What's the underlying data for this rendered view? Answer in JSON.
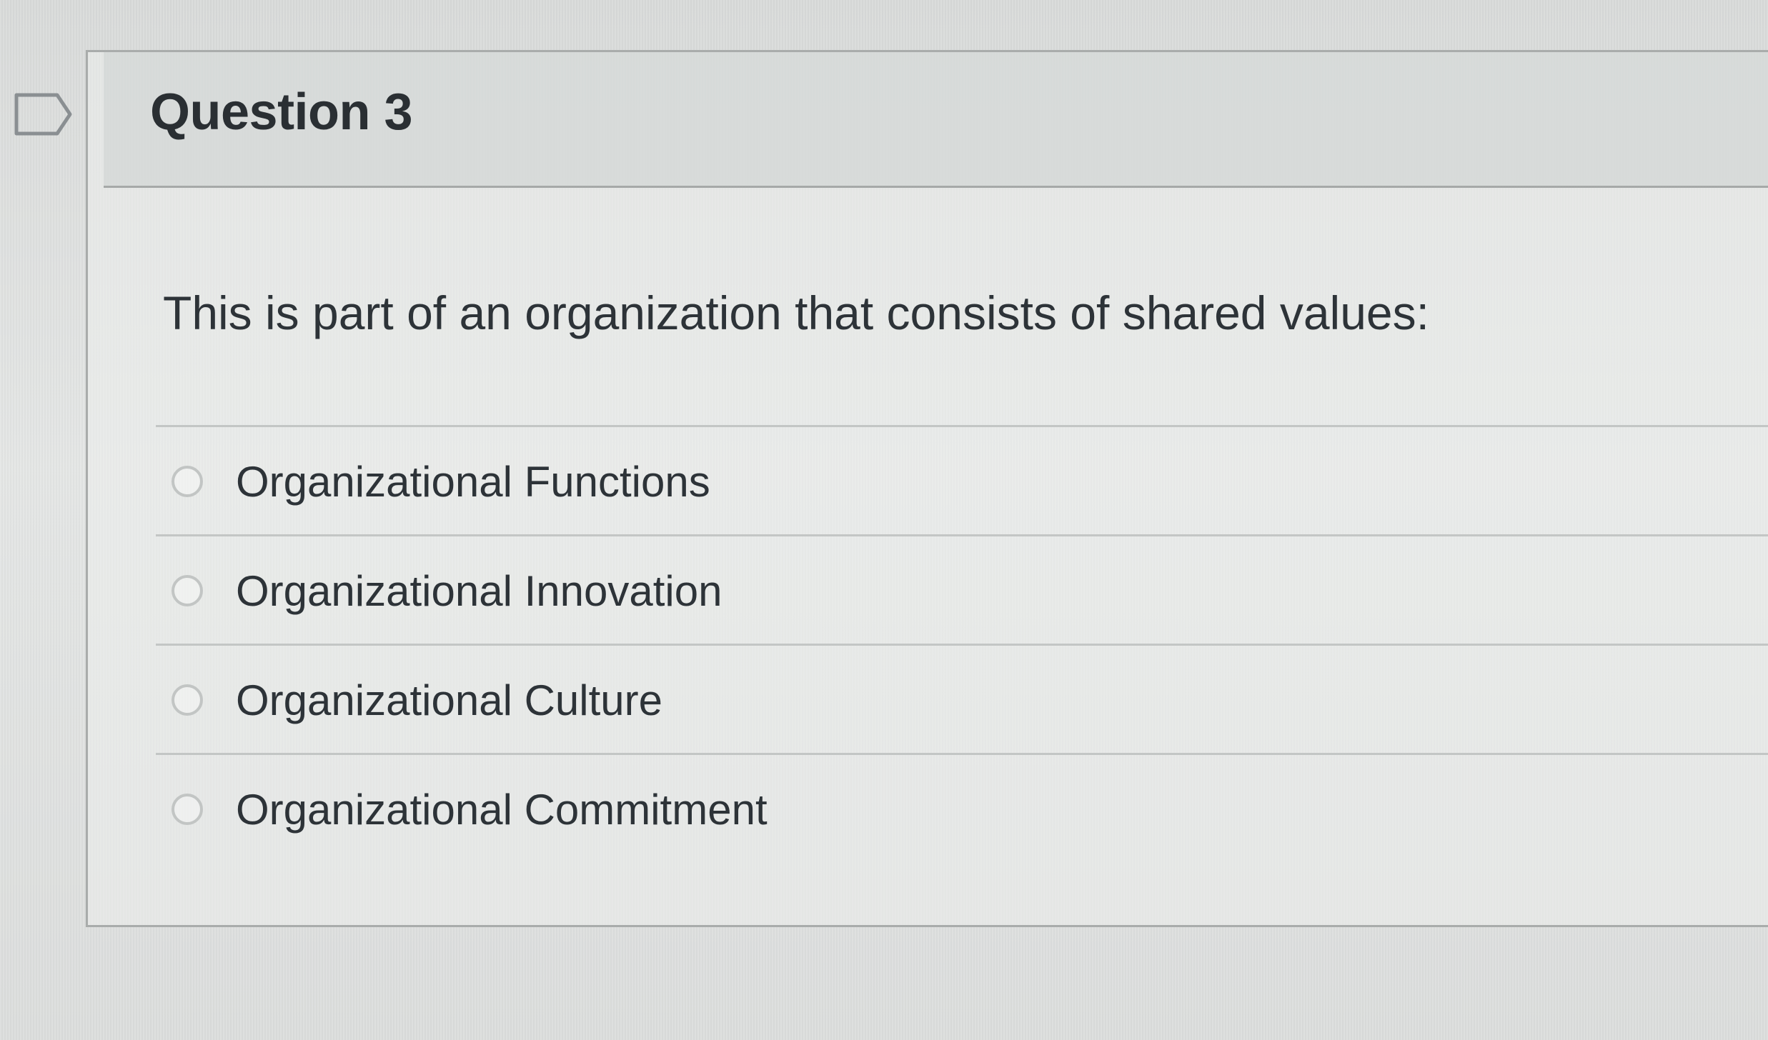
{
  "question": {
    "title": "Question 3",
    "prompt": "This is part of an organization that consists of shared values:",
    "answers": [
      {
        "label": "Organizational Functions",
        "selected": false
      },
      {
        "label": "Organizational Innovation",
        "selected": false
      },
      {
        "label": "Organizational Culture",
        "selected": false
      },
      {
        "label": "Organizational Commitment",
        "selected": false
      }
    ]
  },
  "icons": {
    "flag": "flag-question-icon"
  },
  "colors": {
    "text": "#2d3338",
    "border": "#a9acab",
    "radio_border": "#c2c5c4"
  }
}
